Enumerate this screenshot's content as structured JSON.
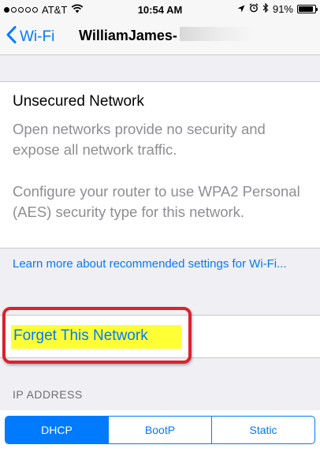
{
  "status_bar": {
    "carrier": "AT&T",
    "time": "10:54 AM",
    "battery_percent": "91%",
    "battery_level": 0.91,
    "signal_bars_filled": 1,
    "signal_bars_total": 5,
    "icons": [
      "wifi-icon",
      "location-arrow-icon",
      "alarm-icon",
      "bluetooth-icon",
      "battery-icon"
    ]
  },
  "nav": {
    "back_label": "Wi-Fi",
    "title": "WilliamJames-"
  },
  "info": {
    "heading": "Unsecured Network",
    "paragraph1": "Open networks provide no security and expose all network traffic.",
    "paragraph2": "Configure your router to use WPA2 Personal (AES) security type for this network.",
    "learn_more": "Learn more about recommended settings for Wi-Fi..."
  },
  "forget": {
    "label": "Forget This Network"
  },
  "ip_section": {
    "header": "IP ADDRESS",
    "segments": [
      "DHCP",
      "BootP",
      "Static"
    ],
    "selected": "DHCP"
  },
  "colors": {
    "accent": "#007aff",
    "highlight": "#ffff33",
    "callout_border": "#d9232d",
    "background": "#efeff4"
  }
}
